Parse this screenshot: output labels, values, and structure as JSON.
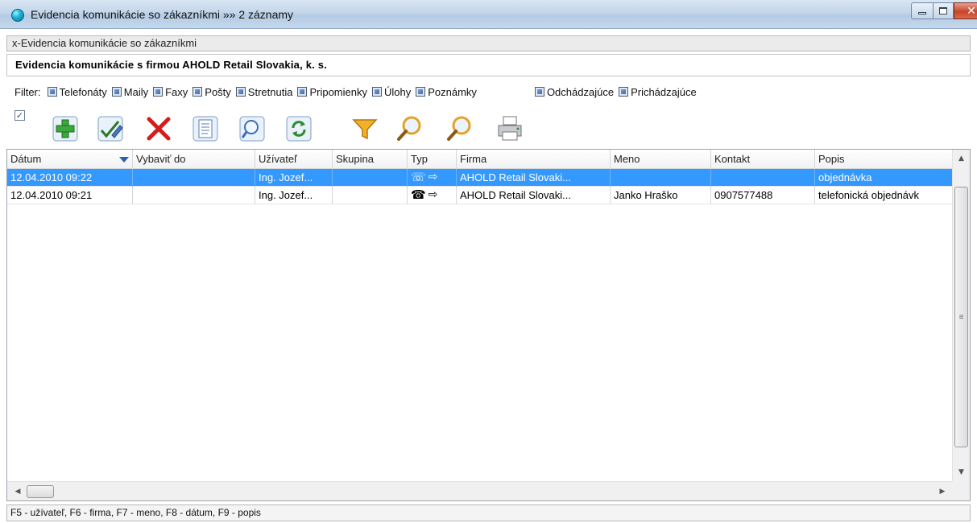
{
  "window": {
    "title": "Evidencia komunikácie so zákazníkmi »» 2 záznamy",
    "close_glyph": "✕"
  },
  "subtitle": "x-Evidencia komunikácie so zákazníkmi",
  "header": "Evidencia komunikácie s firmou AHOLD Retail Slovakia, k. s.",
  "filter": {
    "label": "Filter:",
    "types": [
      "Telefonáty",
      "Maily",
      "Faxy",
      "Pošty",
      "Stretnutia",
      "Pripomienky",
      "Úlohy",
      "Poznámky"
    ],
    "directions": [
      "Odchádzajúce",
      "Prichádzajúce"
    ]
  },
  "toolbar": {
    "select_all_mark": "✓",
    "icons": [
      "add-icon",
      "edit-icon",
      "delete-icon",
      "copy-icon",
      "preview-icon",
      "refresh-icon",
      "filter-icon",
      "search-icon",
      "search-next-icon",
      "print-icon"
    ]
  },
  "grid": {
    "columns": [
      "Dátum",
      "Vybaviť do",
      "Užívateľ",
      "Skupina",
      "Typ",
      "Firma",
      "Meno",
      "Kontakt",
      "Popis"
    ],
    "rows": [
      {
        "datum": "12.04.2010  09:22",
        "vybavit": "",
        "uzivatel": "Ing. Jozef...",
        "skupina": "",
        "typ_icon": "fax-icon",
        "typ_glyph": "☏",
        "dir_glyph": "⇨",
        "firma": "AHOLD Retail Slovaki...",
        "meno": "",
        "kontakt": "",
        "popis": "objednávka",
        "selected": true
      },
      {
        "datum": "12.04.2010  09:21",
        "vybavit": "",
        "uzivatel": "Ing. Jozef...",
        "skupina": "",
        "typ_icon": "phone-icon",
        "typ_glyph": "☎",
        "dir_glyph": "⇨",
        "firma": "AHOLD Retail Slovaki...",
        "meno": "Janko Hraško",
        "kontakt": "0907577488",
        "popis": "telefonická objednávk",
        "selected": false
      }
    ]
  },
  "scroll_glyphs": {
    "up": "▲",
    "down": "▼",
    "left": "◀",
    "right": "▶",
    "grip": "≡"
  },
  "statusbar": "F5 - užívateľ, F6 - firma, F7 - meno, F8 - dátum, F9 - popis",
  "colors": {
    "selection": "#3399ff",
    "accent": "#2a5fb5"
  }
}
